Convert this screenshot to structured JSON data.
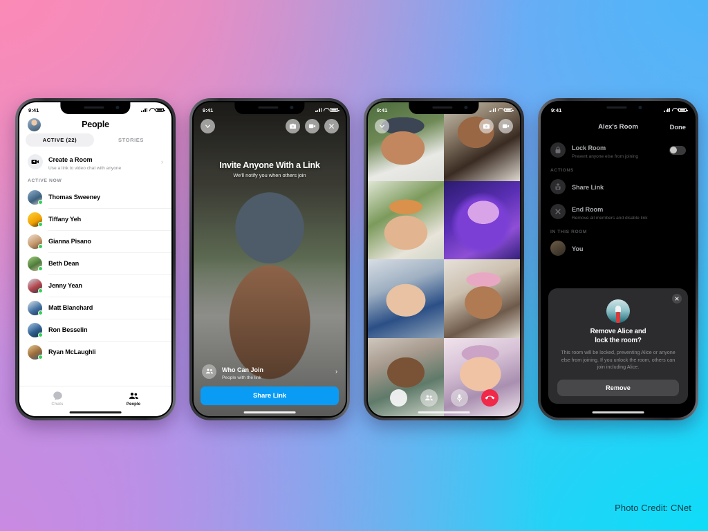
{
  "background": {
    "corner_top_left": "#fb8ab6",
    "corner_top_right": "#4fb5f8",
    "corner_bottom_left": "#c98ae2",
    "corner_bottom_right": "#0fdcf8"
  },
  "credit": "Photo Credit: CNet",
  "phone1": {
    "status": {
      "time": "9:41"
    },
    "title": "People",
    "tabs": [
      {
        "label": "ACTIVE (22)",
        "selected": true
      },
      {
        "label": "STORIES",
        "selected": false
      }
    ],
    "create_room": {
      "title": "Create a Room",
      "subtitle": "Use a link to video chat with anyone",
      "chevron": "›"
    },
    "section_label": "ACTIVE NOW",
    "people": [
      {
        "name": "Thomas Sweeney"
      },
      {
        "name": "Tiffany Yeh"
      },
      {
        "name": "Gianna Pisano"
      },
      {
        "name": "Beth Dean"
      },
      {
        "name": "Jenny Yean"
      },
      {
        "name": "Matt Blanchard"
      },
      {
        "name": "Ron Besselin"
      },
      {
        "name": "Ryan McLaughli"
      }
    ],
    "tabbar": [
      {
        "label": "Chats",
        "active": false
      },
      {
        "label": "People",
        "active": true
      }
    ]
  },
  "phone2": {
    "status": {
      "time": "9:41"
    },
    "headline": "Invite Anyone With a Link",
    "subhead": "We'll notify you when others join",
    "who_can_join": {
      "title": "Who Can Join",
      "subtitle": "People with the link",
      "chevron": "›"
    },
    "share_button": "Share Link"
  },
  "phone3": {
    "status": {
      "time": "9:41"
    },
    "participant_count": 8
  },
  "phone4": {
    "status": {
      "time": "9:41"
    },
    "title": "Alex's Room",
    "done": "Done",
    "lock_room": {
      "title": "Lock Room",
      "subtitle": "Prevent anyone else from joining",
      "enabled": false
    },
    "actions_label": "ACTIONS",
    "actions": [
      {
        "title": "Share Link",
        "subtitle": ""
      },
      {
        "title": "End Room",
        "subtitle": "Remove all members and disable link"
      }
    ],
    "in_room_label": "IN THIS ROOM",
    "in_room": [
      {
        "name": "You"
      }
    ],
    "modal": {
      "heading_line1": "Remove Alice and",
      "heading_line2": "lock the room?",
      "body": "This room will be locked, preventing Alice or anyone else from joining. If you unlock the room, others can join including Alice.",
      "button": "Remove"
    }
  }
}
